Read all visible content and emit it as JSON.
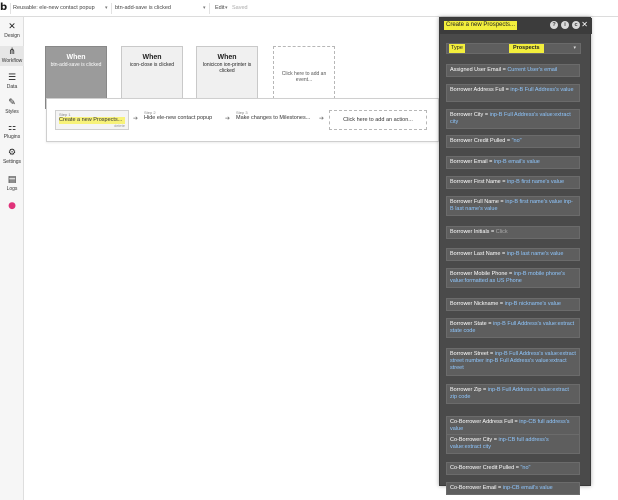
{
  "topbar": {
    "logo": "b",
    "reusable_label": "Reusable: ele-new contact popup",
    "event_label": "btn-add-save is clicked",
    "edit_label": "Edit",
    "saved_label": "Saved"
  },
  "sidebar": {
    "items": [
      {
        "label": "Design",
        "icon": "design-icon"
      },
      {
        "label": "Workflow",
        "icon": "workflow-icon"
      },
      {
        "label": "Data",
        "icon": "database-icon"
      },
      {
        "label": "Styles",
        "icon": "brush-icon"
      },
      {
        "label": "Plugins",
        "icon": "plugin-icon"
      },
      {
        "label": "Settings",
        "icon": "gear-icon"
      },
      {
        "label": "Logs",
        "icon": "document-icon"
      },
      {
        "label": "",
        "icon": "circle-icon"
      }
    ],
    "expand_arrow": "▸"
  },
  "events": [
    {
      "when": "When",
      "subject": "btn-add-save is clicked",
      "active": true
    },
    {
      "when": "When",
      "subject": "icon-close is clicked",
      "active": false
    },
    {
      "when": "When",
      "subject": "Ionicicon ion-printer is clicked",
      "active": false
    },
    {
      "when": "",
      "subject": "Click here to add an event...",
      "active": false
    }
  ],
  "actions": {
    "steps": [
      {
        "number": "Step 1",
        "label": "Create a new Prospects...",
        "delete": "delete"
      },
      {
        "number": "Step 2",
        "label": "Hide ele-new contact popup"
      },
      {
        "number": "Step 3",
        "label": "Make changes to Milestones..."
      }
    ],
    "add_label": "Click here to add an action..."
  },
  "panel": {
    "title": "Create a new Prospects...",
    "header_icons": [
      "?",
      "i",
      "c"
    ],
    "close": "✕",
    "type_label": "Type",
    "type_value": "Prospects",
    "fields": [
      {
        "key": "Assigned User Email",
        "value": "Current User's email"
      },
      {
        "key": "Borrower Address Full",
        "value": "inp-B Full Address's value"
      },
      {
        "key": "Borrower City",
        "value": "inp-B Full Address's value:extract city"
      },
      {
        "key": "Borrower Credit Pulled",
        "value": "\"no\""
      },
      {
        "key": "Borrower Email",
        "value": "inp-B email's value"
      },
      {
        "key": "Borrower First Name",
        "value": "inp-B first name's value"
      },
      {
        "key": "Borrower Full Name",
        "value": "inp-B first name's value inp-B last name's value"
      },
      {
        "key": "Borrower Initials",
        "value": "Click"
      },
      {
        "key": "Borrower Last Name",
        "value": "inp-B last name's value"
      },
      {
        "key": "Borrower Mobile Phone",
        "value": "inp-B mobile phone's value:formatted as US Phone"
      },
      {
        "key": "Borrower Nickname",
        "value": "inp-B nickname's value"
      },
      {
        "key": "Borrower State",
        "value": "inp-B Full Address's value:extract state code"
      },
      {
        "key": "Borrower Street",
        "value": "inp-B Full Address's value:extract street number inp-B Full Address's value:extract street"
      },
      {
        "key": "Borrower Zip",
        "value": "inp-B Full Address's value:extract zip code"
      },
      {
        "key": "Co-Borrower Address Full",
        "value": "inp-CB full address's value"
      },
      {
        "key": "Co-Borrower City",
        "value": "inp-CB full address's value:extract city"
      },
      {
        "key": "Co-Borrower Credit Pulled",
        "value": "\"no\""
      },
      {
        "key": "Co-Borrower Email",
        "value": "inp-CB email's value"
      }
    ]
  },
  "colors": {
    "highlight": "#f2ee3c",
    "panel_bg": "#4a4a4a",
    "value_text": "#8fc7ff"
  }
}
